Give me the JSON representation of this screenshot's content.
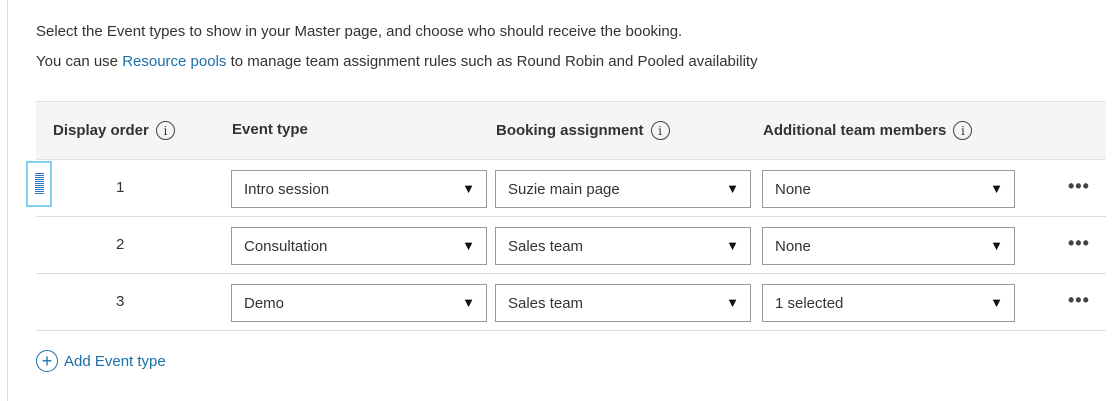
{
  "intro": {
    "line1": "Select the Event types to show in your Master page, and choose who should receive the booking.",
    "line2_before": "You can use ",
    "line2_link": "Resource pools",
    "line2_after": " to manage team assignment rules such as Round Robin and Pooled availability"
  },
  "table": {
    "headers": {
      "display_order": "Display order",
      "event_type": "Event type",
      "booking_assignment": "Booking assignment",
      "additional_team_members": "Additional team members"
    },
    "info_glyph": "i",
    "rows": [
      {
        "order": "1",
        "event_type": "Intro session",
        "booking_assignment": "Suzie main page",
        "additional": "None"
      },
      {
        "order": "2",
        "event_type": "Consultation",
        "booking_assignment": "Sales team",
        "additional": "None"
      },
      {
        "order": "3",
        "event_type": "Demo",
        "booking_assignment": "Sales team",
        "additional": "1 selected"
      }
    ],
    "caret": "▼",
    "more": "•••"
  },
  "add": {
    "plus": "+",
    "label": "Add Event type"
  },
  "colors": {
    "link": "#1a6fa8",
    "header_bg": "#f5f5f5",
    "drag_highlight": "#7fd3f0"
  },
  "icons": [
    "info-icon",
    "drag-handle-icon",
    "chevron-down-icon",
    "more-options-icon",
    "plus-circle-icon"
  ]
}
